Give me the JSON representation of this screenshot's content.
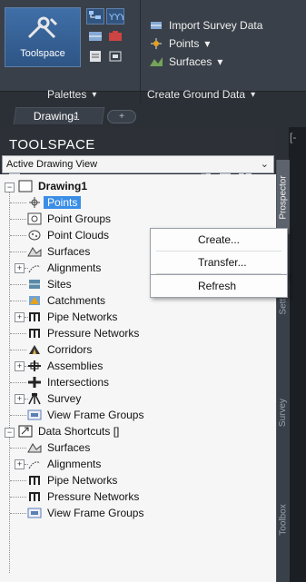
{
  "ribbon": {
    "toolspace_label": "Toolspace",
    "import_survey_data": "Import Survey Data",
    "points": "Points",
    "surfaces": "Surfaces",
    "dropdown_caret": "▾",
    "palettes": "Palettes",
    "create_ground_data": "Create Ground Data"
  },
  "tabs": {
    "drawing_tab": "Drawing1",
    "close_glyph": "✕",
    "add_glyph": "+"
  },
  "toolspace": {
    "title": "TOOLSPACE",
    "view_select": "Active Drawing View",
    "select_arrow": "⌄"
  },
  "vertical_tabs": [
    "Prospector",
    "Settings",
    "Survey",
    "Toolbox"
  ],
  "tree": {
    "drawing": "Drawing1",
    "items": [
      "Points",
      "Point Groups",
      "Point Clouds",
      "Surfaces",
      "Alignments",
      "Sites",
      "Catchments",
      "Pipe Networks",
      "Pressure Networks",
      "Corridors",
      "Assemblies",
      "Intersections",
      "Survey",
      "View Frame Groups"
    ],
    "data_shortcuts": "Data Shortcuts []",
    "shortcut_items": [
      "Surfaces",
      "Alignments",
      "Pipe Networks",
      "Pressure Networks",
      "View Frame Groups"
    ]
  },
  "context_menu": {
    "items": [
      "Create...",
      "Transfer...",
      "Refresh"
    ]
  },
  "viewport": {
    "bracket": "[-"
  }
}
